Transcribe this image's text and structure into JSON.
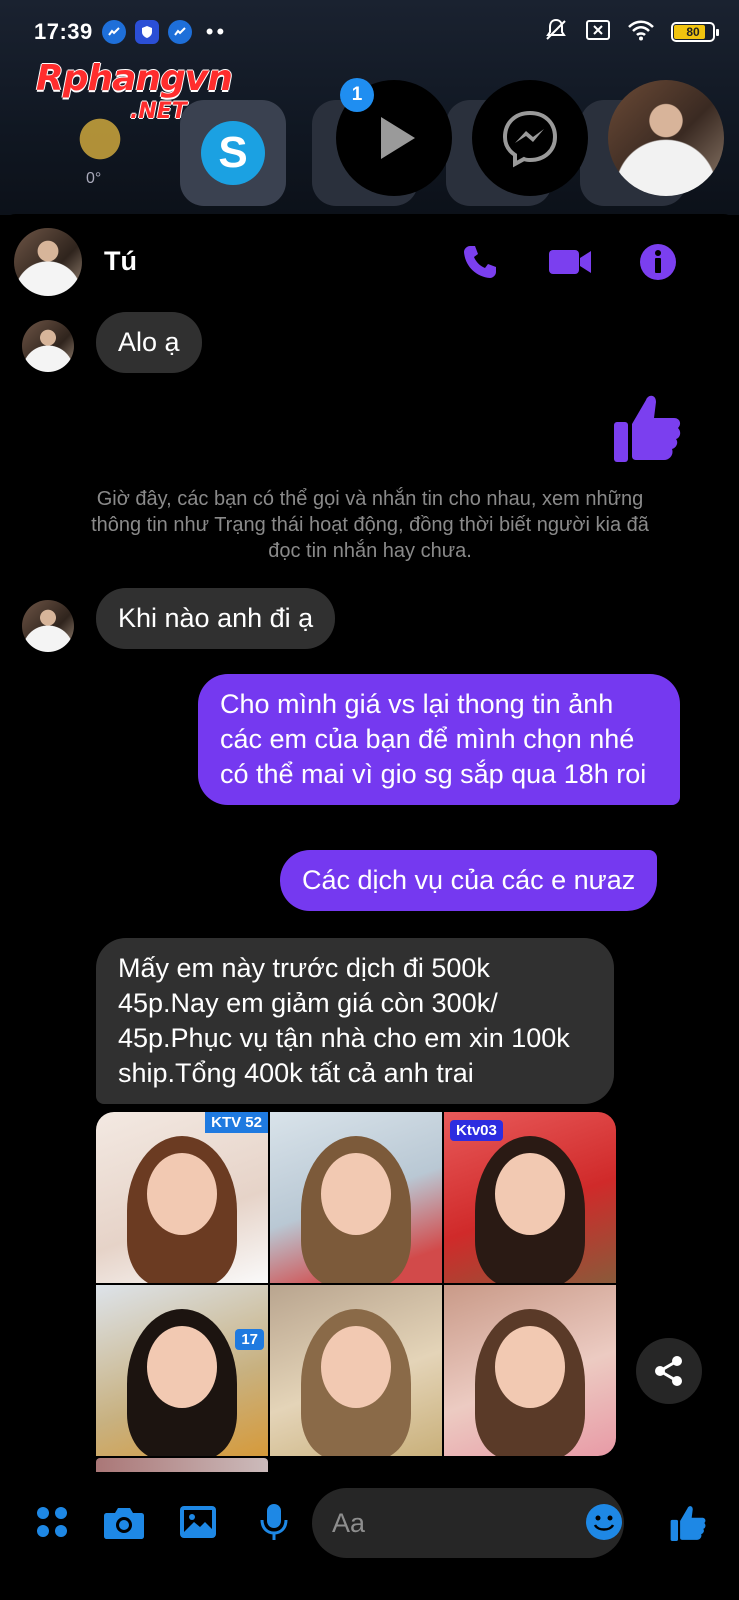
{
  "status_bar": {
    "time": "17:39",
    "battery": "80",
    "notification_icons": [
      "messenger-app-icon",
      "shield-app-icon",
      "messenger-app-icon"
    ],
    "right_icons": [
      "mute-icon",
      "sim-off-icon",
      "wifi-icon",
      "battery-icon"
    ]
  },
  "watermark": {
    "brand": "Rphangvn",
    "suffix": ".NET"
  },
  "launcher": {
    "weather_temp": "0°",
    "skype_letter": "S",
    "badge_count": "1"
  },
  "chat": {
    "contact_name": "Tú",
    "header_actions": [
      "phone-icon",
      "video-call-icon",
      "info-icon"
    ],
    "messages": [
      {
        "from": "them",
        "text": "Alo ạ"
      },
      {
        "from": "me",
        "type": "like"
      },
      {
        "from": "system",
        "text": "Giờ đây, các bạn có thể gọi và nhắn tin cho nhau, xem những thông tin như Trạng thái hoạt động, đồng thời biết người kia đã đọc tin nhắn hay chưa."
      },
      {
        "from": "them",
        "text": "Khi nào anh đi ạ"
      },
      {
        "from": "me",
        "text": "Cho mình giá vs lại thong tin ảnh các em của bạn để mình chọn nhé có thể mai vì gio sg sắp qua 18h roi"
      },
      {
        "from": "me",
        "text": "Các dịch vụ của các e nưaz"
      },
      {
        "from": "them",
        "text": "Mấy em này trước dịch đi 500k 45p.Nay em giảm giá còn 300k/ 45p.Phục vụ tận nhà cho em xin 100k ship.Tổng 400k tất cả anh trai"
      }
    ],
    "photos": [
      {
        "tag": "KTV 52",
        "tag_color": "#1f7ae0"
      },
      {
        "tag": "",
        "tag_color": ""
      },
      {
        "tag": "Ktv03",
        "tag_color": "#2d2de0"
      },
      {
        "tag": "17",
        "tag_color": "#1f7ae0"
      },
      {
        "tag": "",
        "tag_color": ""
      },
      {
        "tag": "",
        "tag_color": ""
      }
    ]
  },
  "composer": {
    "placeholder": "Aa",
    "actions": [
      "apps-icon",
      "camera-icon",
      "gallery-icon",
      "mic-icon",
      "emoji-icon",
      "like-icon"
    ]
  },
  "colors": {
    "accent": "#7539f0",
    "them_bubble": "#303030",
    "icon": "#7b3fef",
    "composer_icon": "#1e88e5"
  }
}
